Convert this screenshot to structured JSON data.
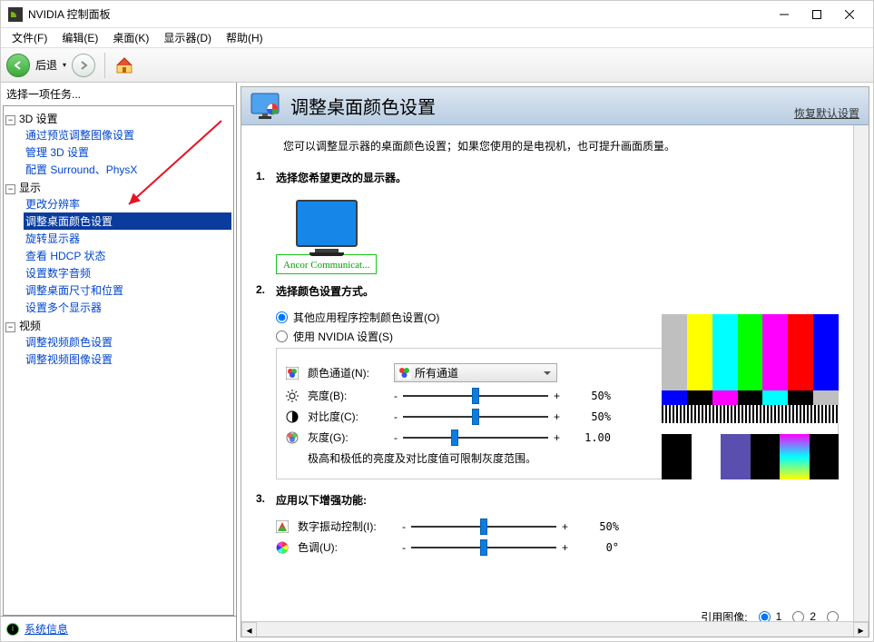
{
  "titlebar": {
    "title": "NVIDIA 控制面板"
  },
  "menus": [
    "文件(F)",
    "编辑(E)",
    "桌面(K)",
    "显示器(D)",
    "帮助(H)"
  ],
  "toolbar": {
    "back_label": "后退"
  },
  "sidebar": {
    "task_title": "选择一项任务...",
    "groups": [
      {
        "label": "3D 设置",
        "items": [
          "通过预览调整图像设置",
          "管理 3D 设置",
          "配置 Surround、PhysX"
        ]
      },
      {
        "label": "显示",
        "items": [
          "更改分辨率",
          "调整桌面颜色设置",
          "旋转显示器",
          "查看 HDCP 状态",
          "设置数字音频",
          "调整桌面尺寸和位置",
          "设置多个显示器"
        ],
        "selected": 1
      },
      {
        "label": "视频",
        "items": [
          "调整视频颜色设置",
          "调整视频图像设置"
        ]
      }
    ],
    "sysinfo": "系统信息"
  },
  "page": {
    "title": "调整桌面颜色设置",
    "restore": "恢复默认设置",
    "intro": "您可以调整显示器的桌面颜色设置；如果您使用的是电视机，也可提升画面质量。",
    "sec1": {
      "num": "1.",
      "title": "选择您希望更改的显示器。",
      "monitor_caption": "Ancor Communicat..."
    },
    "sec2": {
      "num": "2.",
      "title": "选择颜色设置方式。",
      "radio1": "其他应用程序控制颜色设置(O)",
      "radio2": "使用 NVIDIA 设置(S)",
      "channel_label": "颜色通道(N):",
      "channel_value": "所有通道",
      "brightness_label": "亮度(B):",
      "contrast_label": "对比度(C):",
      "gamma_label": "灰度(G):",
      "brightness_val": "50%",
      "contrast_val": "50%",
      "gamma_val": "1.00",
      "hint": "极高和极低的亮度及对比度值可限制灰度范围。"
    },
    "sec3": {
      "num": "3.",
      "title": "应用以下增强功能:",
      "vibrance_label": "数字振动控制(I):",
      "hue_label": "色调(U):",
      "vibrance_val": "50%",
      "hue_val": "0°"
    },
    "ref": {
      "label": "引用图像:",
      "opt1": "1",
      "opt2": "2"
    }
  }
}
